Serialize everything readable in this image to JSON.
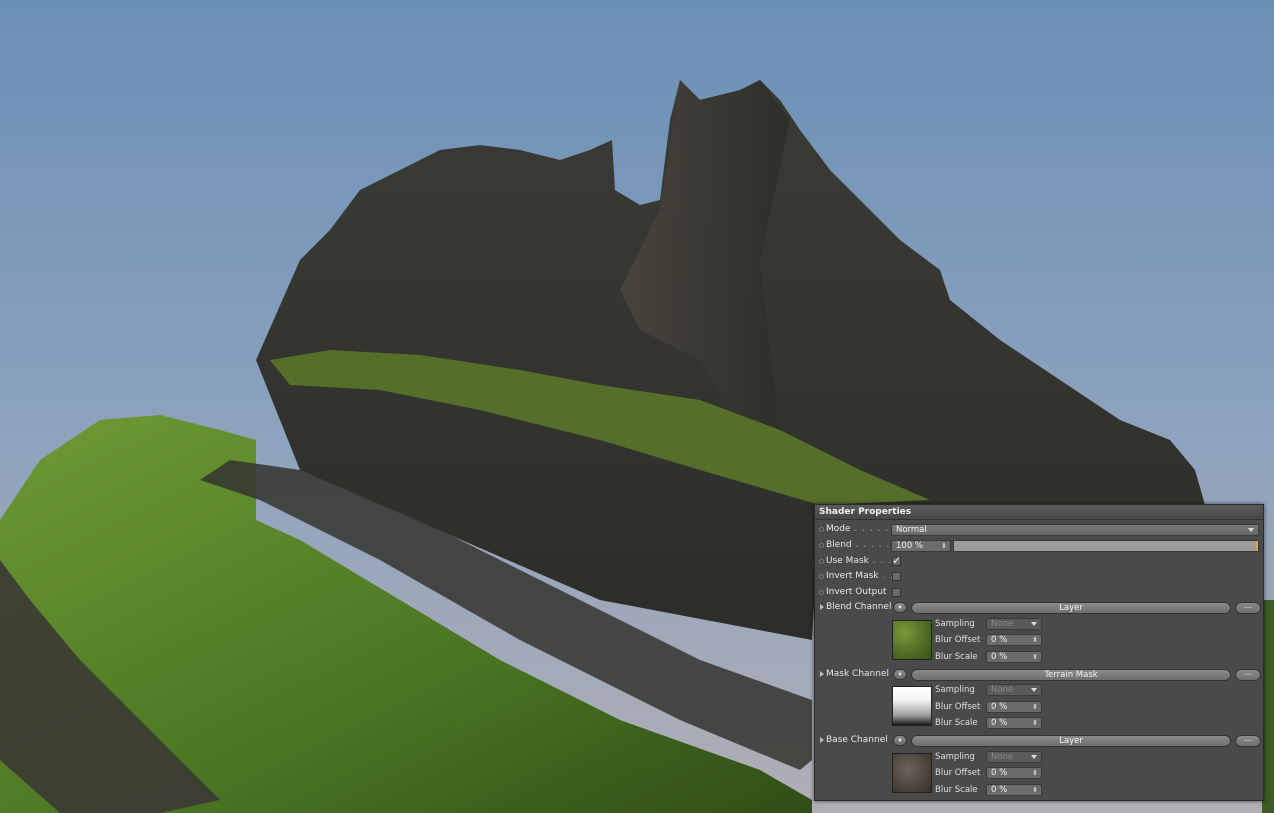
{
  "panel": {
    "title": "Shader Properties",
    "mode": {
      "label": "Mode",
      "value": "Normal"
    },
    "blend": {
      "label": "Blend",
      "value": "100 %",
      "fraction": 1.0
    },
    "use_mask": {
      "label": "Use Mask",
      "checked": true
    },
    "invert_mask": {
      "label": "Invert Mask",
      "checked": false
    },
    "invert_output": {
      "label": "Invert Output",
      "checked": false
    },
    "channels": [
      {
        "label": "Blend Channel",
        "button": "Layer",
        "sampling_label": "Sampling",
        "sampling": "None",
        "blur_offset_label": "Blur Offset",
        "blur_offset": "0 %",
        "blur_scale_label": "Blur Scale",
        "blur_scale": "0 %",
        "thumb_color": "#5e7a2c"
      },
      {
        "label": "Mask Channel",
        "button": "Terrain Mask",
        "sampling_label": "Sampling",
        "sampling": "None",
        "blur_offset_label": "Blur Offset",
        "blur_offset": "0 %",
        "blur_scale_label": "Blur Scale",
        "blur_scale": "0 %",
        "thumb_color": "#ffffff"
      },
      {
        "label": "Base Channel",
        "button": "Layer",
        "sampling_label": "Sampling",
        "sampling": "None",
        "blur_offset_label": "Blur Offset",
        "blur_offset": "0 %",
        "blur_scale_label": "Blur Scale",
        "blur_scale": "0 %",
        "thumb_color": "#5a5148"
      }
    ],
    "ellipsis": "..."
  },
  "colors": {
    "sky_top": "#6f93b8",
    "sky_bottom": "#a7aab5",
    "grass": "#4f7a23",
    "rock": "#3a3a34",
    "panel_bg": "#4a4a4a",
    "accent": "#e0a63a"
  }
}
